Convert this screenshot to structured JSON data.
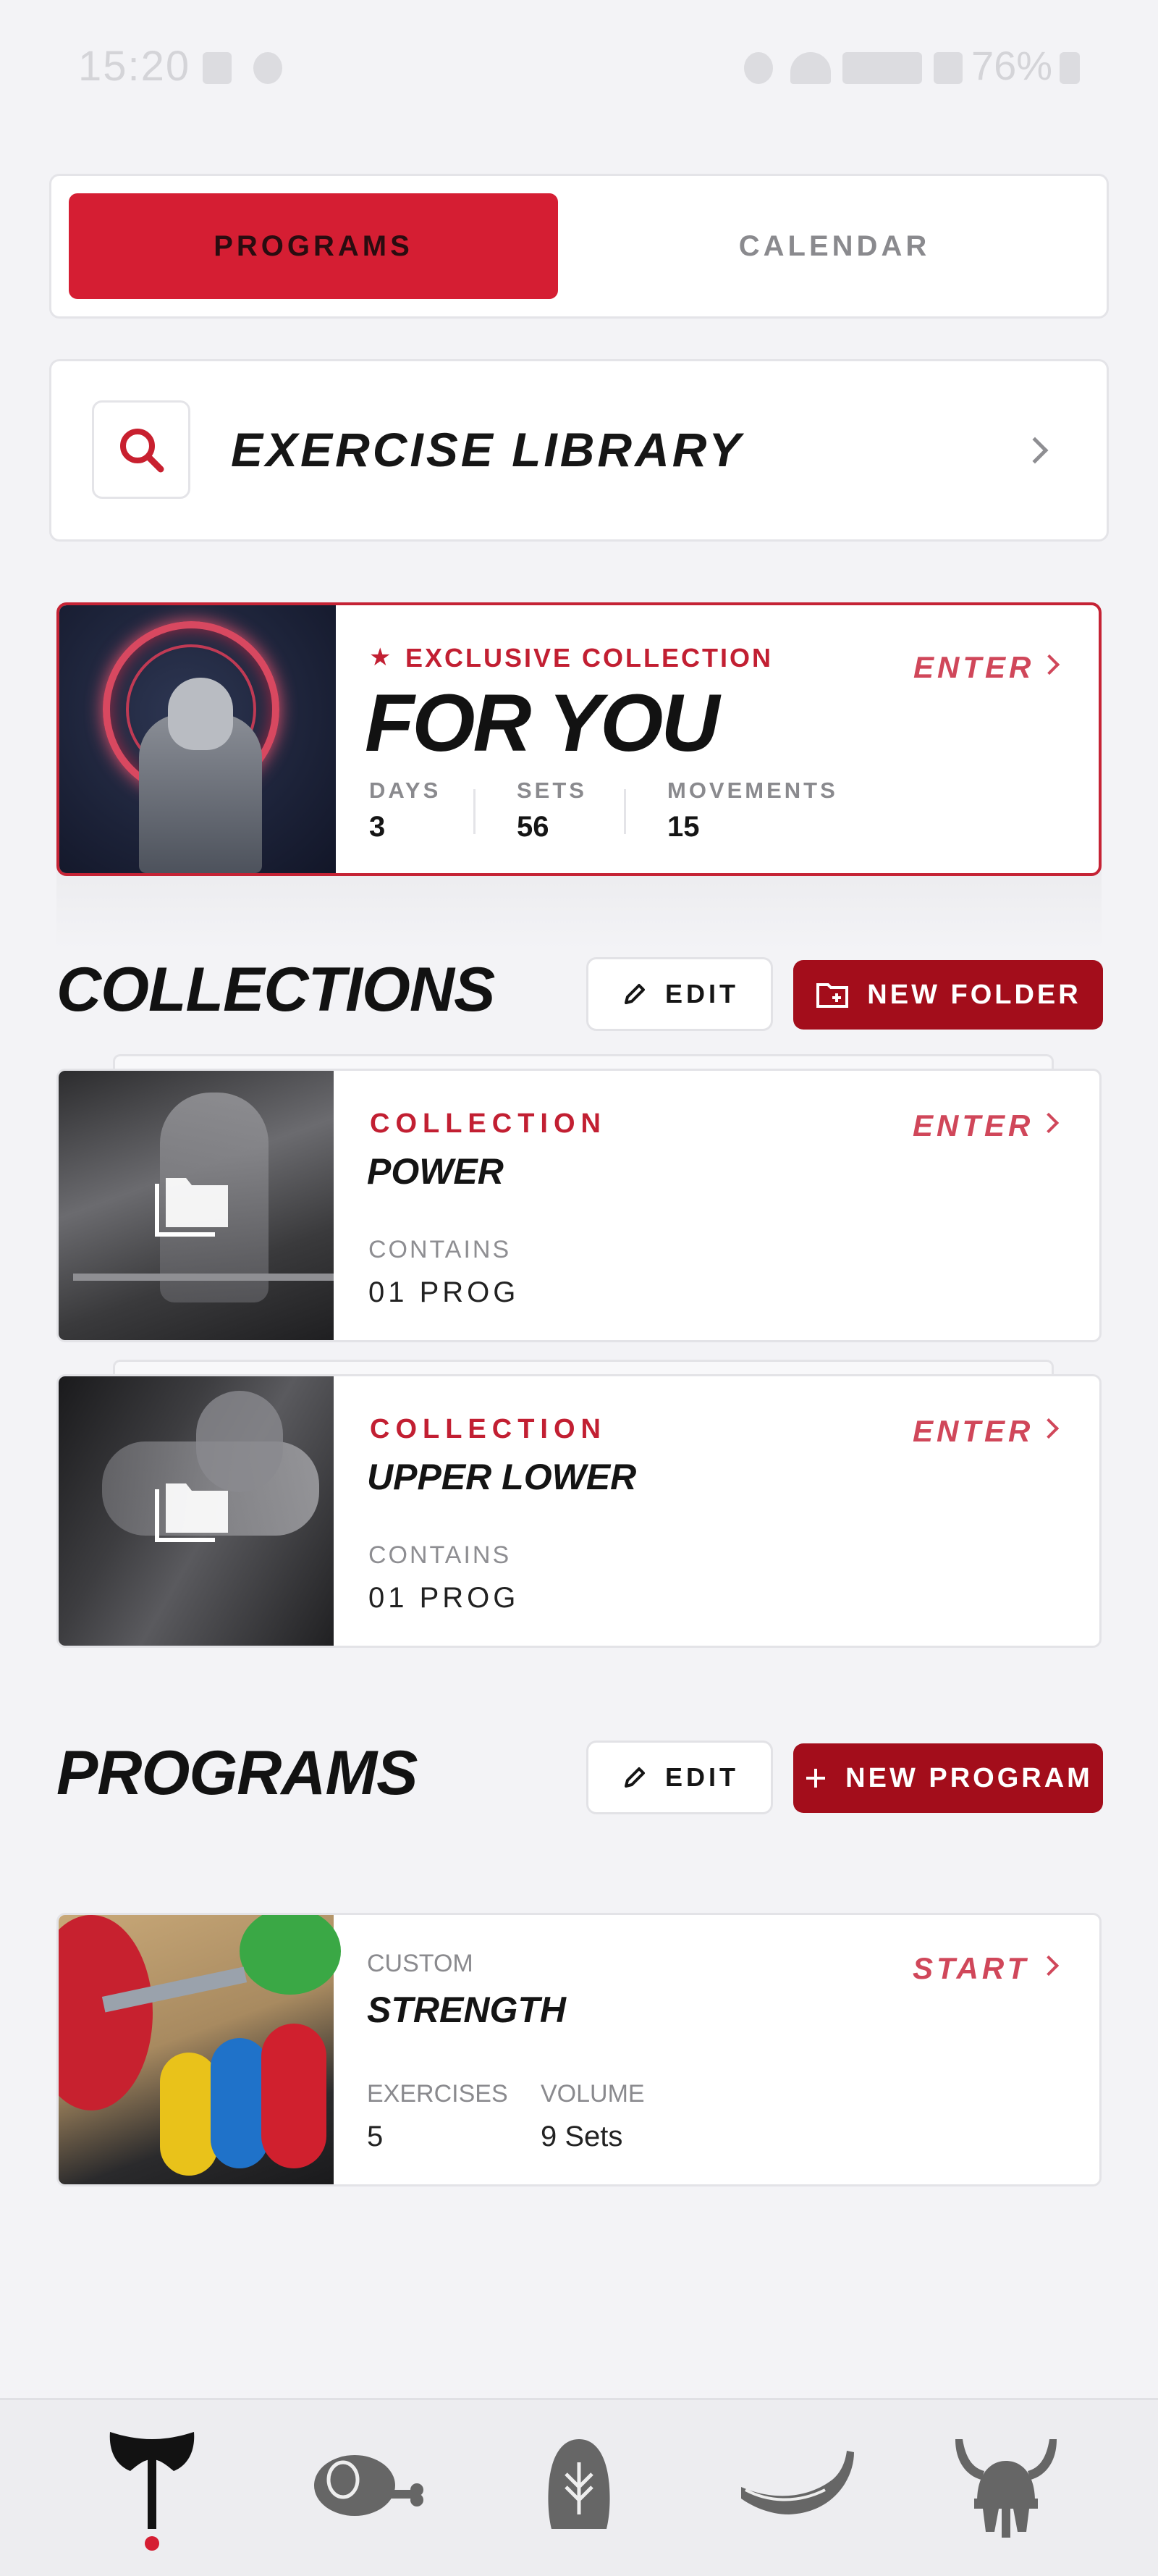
{
  "status_bar": {
    "time": "15:20",
    "battery": "76%"
  },
  "tabs": {
    "programs": "PROGRAMS",
    "calendar": "CALENDAR",
    "selected": "PROGRAMS"
  },
  "exercise_library": {
    "title": "EXERCISE LIBRARY",
    "icon": "search-icon"
  },
  "featured": {
    "kicker": "EXCLUSIVE COLLECTION",
    "title": "FOR YOU",
    "action": "ENTER",
    "stats": [
      {
        "label": "DAYS",
        "value": "3"
      },
      {
        "label": "SETS",
        "value": "56"
      },
      {
        "label": "MOVEMENTS",
        "value": "15"
      }
    ]
  },
  "collections": {
    "heading": "COLLECTIONS",
    "edit_label": "EDIT",
    "new_label": "NEW FOLDER",
    "items": [
      {
        "kicker": "COLLECTION",
        "title": "POWER",
        "action": "ENTER",
        "contains_label": "CONTAINS",
        "contains_value": "01 PROG"
      },
      {
        "kicker": "COLLECTION",
        "title": "UPPER LOWER",
        "action": "ENTER",
        "contains_label": "CONTAINS",
        "contains_value": "01 PROG"
      }
    ]
  },
  "programs": {
    "heading": "PROGRAMS",
    "edit_label": "EDIT",
    "new_label": "NEW PROGRAM",
    "items": [
      {
        "kicker": "CUSTOM",
        "title": "STRENGTH",
        "action": "START",
        "stats": [
          {
            "label": "EXERCISES",
            "value": "5"
          },
          {
            "label": "VOLUME",
            "value": "9 Sets"
          }
        ]
      }
    ]
  },
  "bottom_nav": {
    "items": [
      "axe-icon",
      "ham-icon",
      "rune-stone-icon",
      "drinking-horn-icon",
      "viking-helmet-icon"
    ],
    "active": "axe-icon"
  },
  "colors": {
    "accent": "#d51e33",
    "dark_red": "#a30d1b",
    "background": "#f3f3f6"
  }
}
